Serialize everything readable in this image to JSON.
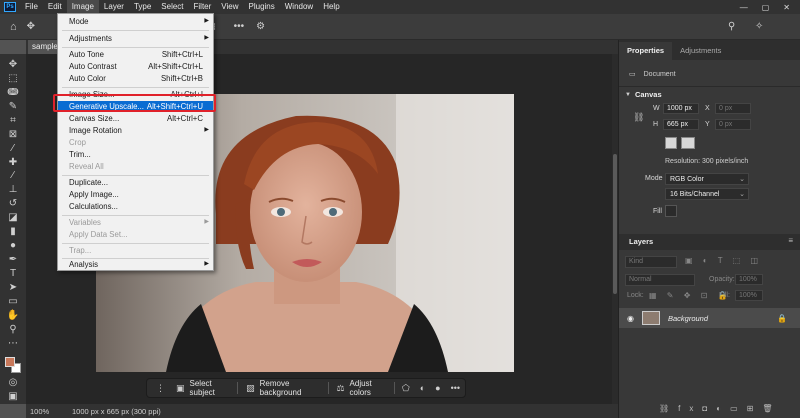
{
  "app": {
    "logo": "Ps"
  },
  "menubar": {
    "items": [
      "File",
      "Edit",
      "Image",
      "Layer",
      "Type",
      "Select",
      "Filter",
      "View",
      "Plugins",
      "Window",
      "Help"
    ],
    "active": "Image"
  },
  "window_controls": {
    "home": "⌂",
    "min": "—",
    "max": "▢",
    "close": "✕",
    "search": "⚲",
    "bulb": "✧"
  },
  "document": {
    "tab": "sample...",
    "zoom": "100%",
    "info": "1000 px x 665 px (300 ppi)"
  },
  "image_menu": {
    "items": [
      {
        "label": "Mode",
        "submenu": true
      },
      {
        "label": "Adjustments",
        "submenu": true
      },
      {
        "label": "Auto Tone",
        "shortcut": "Shift+Ctrl+L"
      },
      {
        "label": "Auto Contrast",
        "shortcut": "Alt+Shift+Ctrl+L"
      },
      {
        "label": "Auto Color",
        "shortcut": "Shift+Ctrl+B"
      },
      {
        "label": "Image Size...",
        "shortcut": "Alt+Ctrl+I"
      },
      {
        "label": "Generative Upscale...",
        "shortcut": "Alt+Shift+Ctrl+U",
        "highlighted": true
      },
      {
        "label": "Canvas Size...",
        "shortcut": "Alt+Ctrl+C"
      },
      {
        "label": "Image Rotation",
        "submenu": true
      },
      {
        "label": "Crop",
        "disabled": true
      },
      {
        "label": "Trim..."
      },
      {
        "label": "Reveal All",
        "disabled": true
      },
      {
        "label": "Duplicate..."
      },
      {
        "label": "Apply Image..."
      },
      {
        "label": "Calculations..."
      },
      {
        "label": "Variables",
        "submenu": true,
        "disabled": true
      },
      {
        "label": "Apply Data Set...",
        "disabled": true
      },
      {
        "label": "Trap...",
        "disabled": true
      },
      {
        "label": "Analysis",
        "submenu": true
      }
    ]
  },
  "taskbar": {
    "select_subject": "Select subject",
    "remove_background": "Remove background",
    "adjust_colors": "Adjust colors"
  },
  "properties": {
    "tab_properties": "Properties",
    "tab_adjustments": "Adjustments",
    "doc_label": "Document",
    "canvas_title": "Canvas",
    "w_label": "W",
    "w_value": "1000 px",
    "h_label": "H",
    "h_value": "665 px",
    "x_label": "X",
    "x_value": "0 px",
    "y_label": "Y",
    "y_value": "0 px",
    "resolution": "Resolution: 300 pixels/inch",
    "mode_label": "Mode",
    "mode_value": "RGB Color",
    "depth_value": "16 Bits/Channel",
    "fill_label": "Fill"
  },
  "layers": {
    "title": "Layers",
    "kind": "Kind",
    "blend": "Normal",
    "opacity_label": "Opacity:",
    "opacity_value": "100%",
    "lock_label": "Lock:",
    "fill_label": "Fill:",
    "fill_value": "100%",
    "layer_name": "Background"
  },
  "colors": {
    "accent_highlight": "#0a6cd2",
    "annotation_box": "#e0212a",
    "foreground": "#c8785a",
    "background": "#ffffff"
  }
}
